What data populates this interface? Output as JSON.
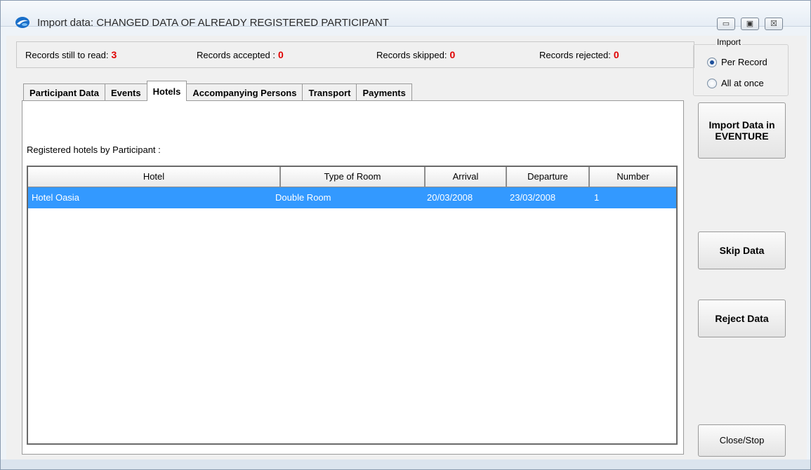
{
  "window": {
    "title": "Import data: CHANGED DATA OF ALREADY REGISTERED PARTICIPANT",
    "controls": {
      "minimize": "▭",
      "maximize": "▣",
      "close": "☒"
    }
  },
  "records": {
    "still_to_read_label": "Records still to read:",
    "still_to_read_value": "3",
    "accepted_label": "Records accepted :",
    "accepted_value": "0",
    "skipped_label": "Records skipped:",
    "skipped_value": "0",
    "rejected_label": "Records rejected:",
    "rejected_value": "0",
    "value_color": "#e00000"
  },
  "import_mode": {
    "legend": "Import",
    "options": [
      {
        "label": "Per Record",
        "selected": true
      },
      {
        "label": "All at once",
        "selected": false
      }
    ]
  },
  "tabs": [
    {
      "label": "Participant Data",
      "active": false
    },
    {
      "label": "Events",
      "active": false
    },
    {
      "label": "Hotels",
      "active": true
    },
    {
      "label": "Accompanying Persons",
      "active": false
    },
    {
      "label": "Transport",
      "active": false
    },
    {
      "label": "Payments",
      "active": false
    }
  ],
  "hotels_panel": {
    "label": "Registered hotels by Participant :",
    "columns": [
      "Hotel",
      "Type of Room",
      "Arrival",
      "Departure",
      "Number"
    ],
    "rows": [
      {
        "hotel": "Hotel Oasia",
        "room_type": "Double Room",
        "arrival": "20/03/2008",
        "departure": "23/03/2008",
        "number": "1",
        "selected": true
      }
    ],
    "selection_color": "#3399ff"
  },
  "actions": {
    "import_line1": "Import Data in",
    "import_line2": "EVENTURE",
    "skip": "Skip Data",
    "reject": "Reject Data",
    "close": "Close/Stop"
  }
}
